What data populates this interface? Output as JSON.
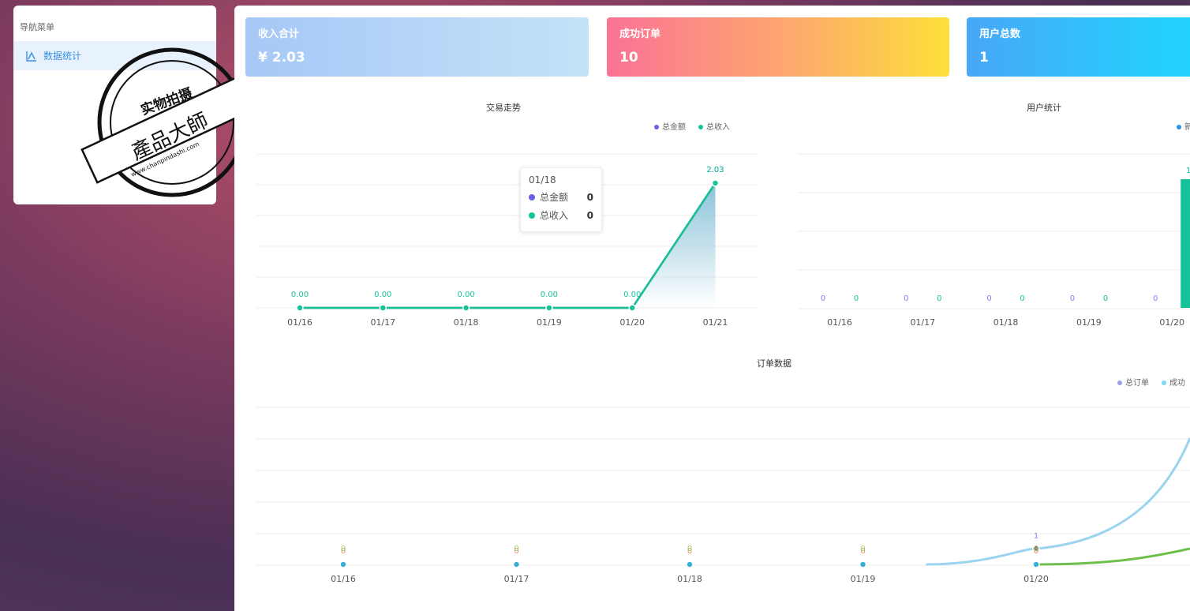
{
  "sidebar": {
    "title": "导航菜单",
    "items": [
      {
        "label": "数据统计",
        "icon": "chart-icon"
      }
    ]
  },
  "watermark": {
    "line1": "实物拍摄",
    "line2": "產品大師",
    "line3": "www.chanpindashi.com"
  },
  "cards": [
    {
      "label": "收入合计",
      "value": "¥ 2.03"
    },
    {
      "label": "成功订单",
      "value": "10"
    },
    {
      "label": "用户总数",
      "value": "1"
    }
  ],
  "tooltip": {
    "date": "01/18",
    "rows": [
      {
        "name": "总金额",
        "value": "0",
        "color": "#6b5ee8"
      },
      {
        "name": "总收入",
        "value": "0",
        "color": "#14c39a"
      }
    ]
  },
  "chart_data": [
    {
      "type": "line",
      "title": "交易走势",
      "categories": [
        "01/16",
        "01/17",
        "01/18",
        "01/19",
        "01/20",
        "01/21"
      ],
      "series": [
        {
          "name": "总金额",
          "values": [
            0,
            0,
            0,
            0,
            0,
            2.03
          ],
          "color": "#6b5ee8",
          "labels": [
            "",
            "",
            "",
            "",
            "",
            "2.03"
          ]
        },
        {
          "name": "总收入",
          "values": [
            0,
            0,
            0,
            0,
            0,
            2.03
          ],
          "color": "#14c39a",
          "labels": [
            "0.00",
            "0.00",
            "0.00",
            "0.00",
            "0.00",
            "2.03"
          ]
        }
      ],
      "legend": "top-right"
    },
    {
      "type": "bar",
      "title": "用户统计",
      "categories": [
        "01/16",
        "01/17",
        "01/18",
        "01/19",
        "01/20"
      ],
      "series": [
        {
          "values": [
            0,
            0,
            0,
            0,
            0
          ],
          "color": "#8e7cf0"
        },
        {
          "values": [
            0,
            0,
            0,
            0,
            1
          ],
          "color": "#14c39a"
        }
      ],
      "legend_visible": [
        "新"
      ],
      "legend": "top-right"
    },
    {
      "type": "line",
      "title": "订单数据",
      "categories": [
        "01/16",
        "01/17",
        "01/18",
        "01/19",
        "01/20"
      ],
      "series": [
        {
          "name": "总订单",
          "values": [
            0,
            0,
            0,
            0,
            1
          ],
          "color": "#9b9ff0"
        },
        {
          "name": "成功",
          "values": [
            0,
            0,
            0,
            0,
            0
          ],
          "color": "#7dd8f0"
        },
        {
          "values": [
            0,
            0,
            0,
            0,
            0
          ],
          "color": "#f08c6c"
        },
        {
          "values": [
            0,
            0,
            0,
            0,
            0
          ],
          "color": "#a0d070"
        }
      ],
      "legend": "top-right"
    }
  ]
}
